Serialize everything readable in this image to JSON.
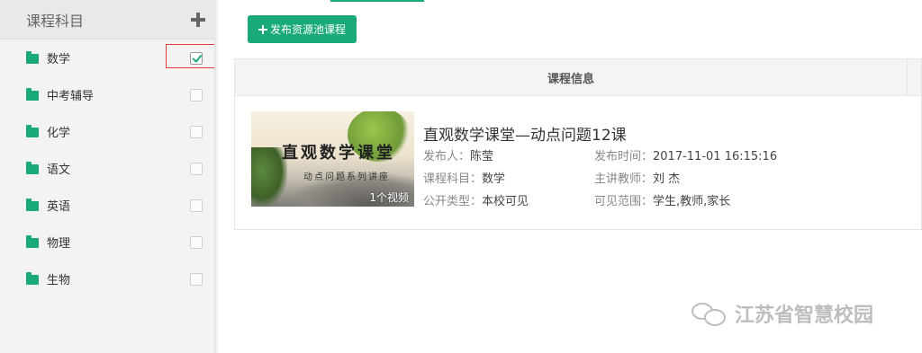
{
  "sidebar": {
    "title": "课程科目",
    "items": [
      {
        "label": "数学",
        "checked": true
      },
      {
        "label": "中考辅导",
        "checked": false
      },
      {
        "label": "化学",
        "checked": false
      },
      {
        "label": "语文",
        "checked": false
      },
      {
        "label": "英语",
        "checked": false
      },
      {
        "label": "物理",
        "checked": false
      },
      {
        "label": "生物",
        "checked": false
      }
    ]
  },
  "toolbar": {
    "publish_label": "发布资源池课程"
  },
  "table": {
    "header": "课程信息"
  },
  "course": {
    "thumb_title": "直观数学课堂",
    "thumb_subtitle": "动点问题系列讲座",
    "video_count": "1个视频",
    "title": "直观数学课堂—动点问题12课",
    "publisher_label": "发布人：",
    "publisher": "陈莹",
    "publish_time_label": "发布时间：",
    "publish_time": "2017-11-01 16:15:16",
    "subject_label": "课程科目：",
    "subject": "数学",
    "teacher_label": "主讲教师：",
    "teacher": "刘 杰",
    "visibility_type_label": "公开类型：",
    "visibility_type": "本校可见",
    "visible_scope_label": "可见范围：",
    "visible_scope": "学生,教师,家长"
  },
  "watermark": {
    "text": "江苏省智慧校园"
  },
  "colors": {
    "accent": "#1aaa7a",
    "highlight": "#e23a3a"
  }
}
